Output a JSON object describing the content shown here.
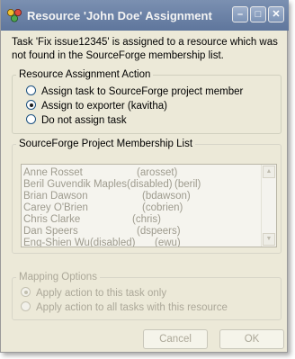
{
  "window": {
    "title": "Resource 'John Doe' Assignment",
    "buttons": {
      "minimize": "–",
      "maximize": "□",
      "close": "✕"
    }
  },
  "message": "Task 'Fix issue12345' is assigned to a resource which was not found in the SourceForge membership list.",
  "assignment": {
    "legend": "Resource Assignment Action",
    "options": [
      {
        "label": "Assign task to SourceForge project member",
        "selected": false
      },
      {
        "label": "Assign to exporter (kavitha)",
        "selected": true
      },
      {
        "label": "Do not assign task",
        "selected": false
      }
    ]
  },
  "membership": {
    "legend": "SourceForge Project Membership List",
    "members": [
      {
        "name": "Anne Rosset",
        "login": "(arosset)"
      },
      {
        "name": "Beril Guvendik Maples(disabled)",
        "login": "(beril)"
      },
      {
        "name": "Brian Dawson",
        "login": "(bdawson)"
      },
      {
        "name": "Carey O'Brien",
        "login": "(cobrien)"
      },
      {
        "name": "Chris Clarke",
        "login": "(chris)"
      },
      {
        "name": "Dan Speers",
        "login": "(dspeers)"
      },
      {
        "name": "Eng-Shien Wu(disabled)",
        "login": "(ewu)"
      }
    ]
  },
  "mapping": {
    "legend": "Mapping Options",
    "options": [
      {
        "label": "Apply action to this task only",
        "selected": true
      },
      {
        "label": "Apply action to all tasks with this resource",
        "selected": false
      }
    ]
  },
  "footer": {
    "cancel_label": "Cancel",
    "ok_label": "OK"
  },
  "colors": {
    "titlebar": "#6e84a8",
    "dialog_bg": "#ece9d8",
    "disabled_text": "#aca899"
  }
}
